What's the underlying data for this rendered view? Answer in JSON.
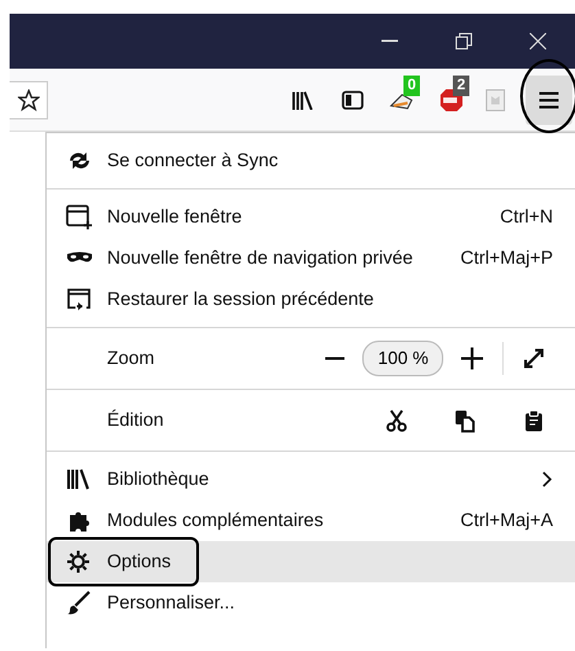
{
  "toolbar": {
    "addon_badges": [
      {
        "count": "0",
        "color": "#22c41e"
      },
      {
        "count": "2",
        "color": "#555555"
      }
    ],
    "menu_button": {
      "circled": true,
      "selected": true
    }
  },
  "menu": {
    "sections": [
      {
        "rows": [
          {
            "kind": "item",
            "label": "Se connecter à Sync",
            "selected": false,
            "circled": false
          }
        ]
      },
      {
        "rows": [
          {
            "kind": "item",
            "label": "Nouvelle fenêtre",
            "shortcut": "Ctrl+N",
            "selected": false,
            "circled": false
          },
          {
            "kind": "item",
            "label": "Nouvelle fenêtre de navigation privée",
            "shortcut": "Ctrl+Maj+P",
            "selected": false,
            "circled": false
          },
          {
            "kind": "item",
            "label": "Restaurer la session précédente",
            "selected": false,
            "circled": false
          }
        ]
      },
      {
        "rows": [
          {
            "kind": "zoom",
            "label": "Zoom",
            "value": "100 %"
          }
        ]
      },
      {
        "rows": [
          {
            "kind": "edit",
            "label": "Édition"
          }
        ]
      },
      {
        "rows": [
          {
            "kind": "item",
            "label": "Bibliothèque",
            "submenu": true,
            "selected": false,
            "circled": false
          },
          {
            "kind": "item",
            "label": "Modules complémentaires",
            "shortcut": "Ctrl+Maj+A",
            "selected": false,
            "circled": false
          },
          {
            "kind": "item",
            "label": "Options",
            "selected": true,
            "circled": true
          },
          {
            "kind": "item",
            "label": "Personnaliser...",
            "selected": false,
            "circled": false
          }
        ]
      }
    ]
  }
}
